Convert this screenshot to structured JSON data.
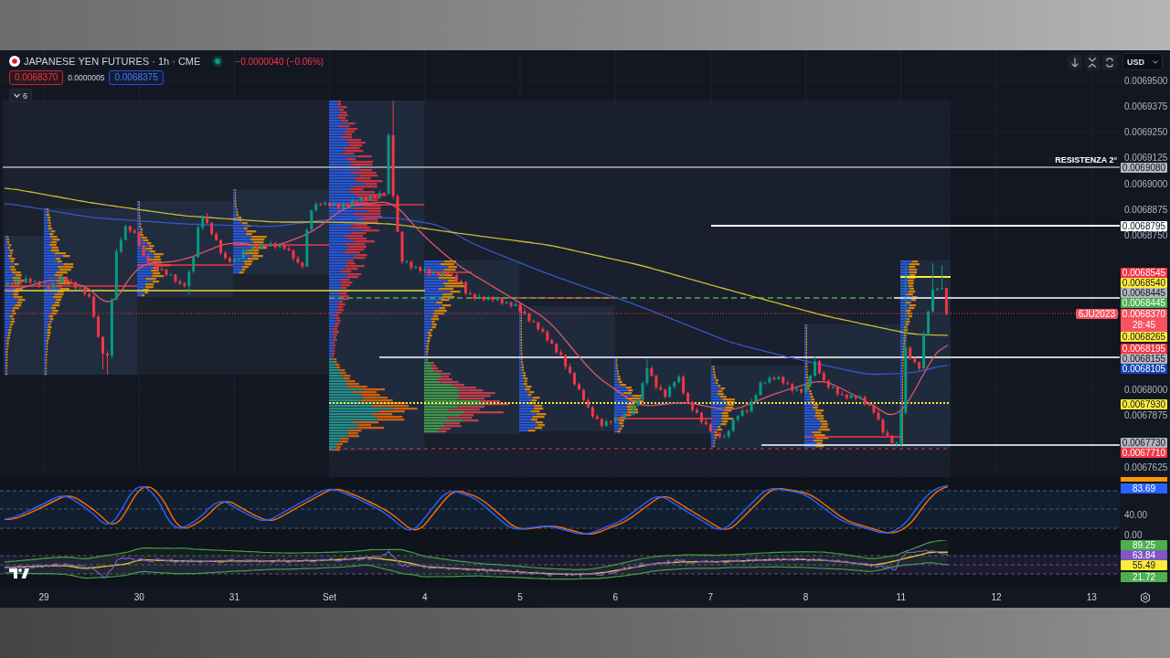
{
  "legend": {
    "symbol": "JAPANESE YEN FUTURES · 1h · CME",
    "change": "−0.0000040 (−0.06%)",
    "bid": "0.0068370",
    "spread": "0.0000005",
    "ask": "0.0068375",
    "indicators_count": "6"
  },
  "toolbar": {
    "currency": "USD"
  },
  "price_axis": {
    "ticks": [
      "0.0069500",
      "0.0069375",
      "0.0069250",
      "0.0069125",
      "0.0069000",
      "0.0068875",
      "0.0068750",
      "0.0068000",
      "0.0067875",
      "0.0067625"
    ],
    "markers": [
      {
        "kind": "level",
        "value": "0.0069080",
        "color": "#b2b5be",
        "label": "RESISTENZA 2°"
      },
      {
        "kind": "level",
        "value": "0.0068795",
        "color": "#ffffff"
      },
      {
        "kind": "level",
        "value": "0.0068545",
        "color": "#f23645"
      },
      {
        "kind": "level",
        "value": "0.0068540",
        "color": "#ffeb3b"
      },
      {
        "kind": "level",
        "value": "0.0068445",
        "color": "#b2b5be"
      },
      {
        "kind": "level",
        "value": "0.0068445",
        "color": "#4caf50"
      },
      {
        "kind": "last",
        "value": "0.0068370",
        "color": "#f7525f",
        "countdown": "28:45",
        "symbol": "6JU2023"
      },
      {
        "kind": "level",
        "value": "0.0068265",
        "color": "#ffeb3b"
      },
      {
        "kind": "level",
        "value": "0.0068195",
        "color": "#f23645"
      },
      {
        "kind": "level",
        "value": "0.0068155",
        "color": "#b2b5be"
      },
      {
        "kind": "level",
        "value": "0.0068105",
        "color": "#1545b5"
      },
      {
        "kind": "level",
        "value": "0.0067930",
        "color": "#ffeb3b"
      },
      {
        "kind": "level",
        "value": "0.0067730",
        "color": "#b2b5be"
      },
      {
        "kind": "level",
        "value": "0.0067710",
        "color": "#f23645"
      }
    ]
  },
  "stochastic": {
    "ticks": [
      "40.00",
      "0.00"
    ],
    "markers": [
      {
        "value": "83.69",
        "color": "#2962ff"
      }
    ]
  },
  "rsi": {
    "markers": [
      {
        "value": "89.25",
        "color": "#4caf50"
      },
      {
        "value": "63.84",
        "color": "#7e57c2"
      },
      {
        "value": "55.49",
        "color": "#ffeb3b"
      },
      {
        "value": "21.72",
        "color": "#4caf50"
      }
    ]
  },
  "time_axis": {
    "labels": [
      "29",
      "30",
      "31",
      "Set",
      "4",
      "5",
      "6",
      "7",
      "8",
      "11",
      "12",
      "13"
    ]
  }
}
